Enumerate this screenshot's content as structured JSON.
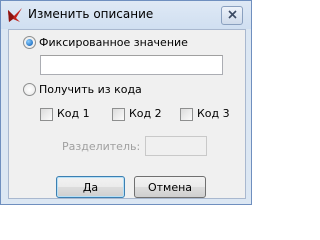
{
  "window": {
    "title": "Изменить описание",
    "icon": "red-sketch-app-icon",
    "close_icon": "close-x-icon"
  },
  "options": {
    "fixed": {
      "label": "Фиксированное значение",
      "selected": true,
      "value": ""
    },
    "from_code": {
      "label": "Получить из кода",
      "selected": false,
      "codes": [
        {
          "label": "Код 1",
          "checked": false
        },
        {
          "label": "Код 2",
          "checked": false
        },
        {
          "label": "Код 3",
          "checked": false
        }
      ],
      "separator_label": "Разделитель:",
      "separator_value": ""
    }
  },
  "buttons": {
    "ok": "Да",
    "cancel": "Отмена"
  }
}
